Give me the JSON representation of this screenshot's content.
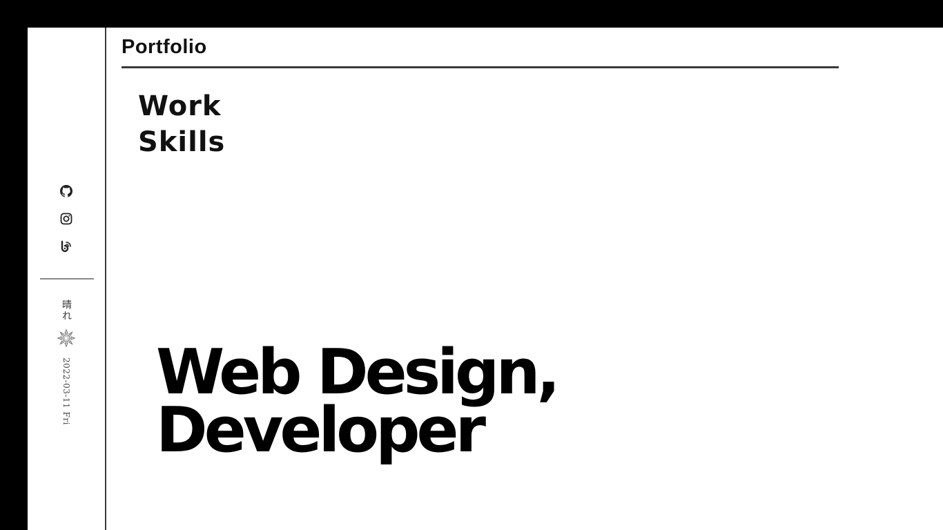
{
  "header": {
    "brand": "Portfolio"
  },
  "nav": {
    "items": [
      {
        "label": "Work"
      },
      {
        "label": "Skills"
      }
    ]
  },
  "sidebar": {
    "social": [
      {
        "icon": "github-icon"
      },
      {
        "icon": "instagram-icon"
      },
      {
        "icon": "blog-rss-icon"
      }
    ],
    "weather": {
      "text": "晴れ",
      "icon": "sun-icon"
    },
    "date": "2022-03-11 Fri"
  },
  "hero": {
    "line1": "Web Design,",
    "line2": "Developer"
  },
  "colors": {
    "background": "#000000",
    "page": "#ffffff",
    "text": "#111111",
    "rule": "#3a3a3a"
  }
}
